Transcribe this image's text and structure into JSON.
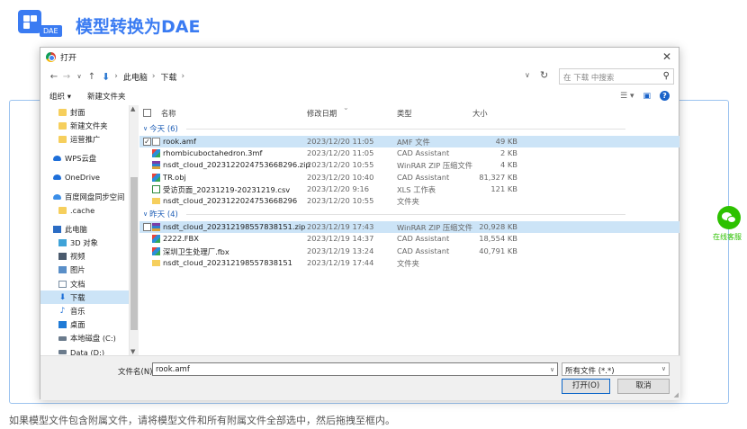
{
  "page": {
    "logo_tag": "DAE",
    "title": "模型转换为DAE",
    "footer_note": "如果模型文件包含附属文件，请将模型文件和所有附属文件全部选中，然后拖拽至框内。",
    "online_service_label": "在线客服"
  },
  "dialog": {
    "title": "打开",
    "close": "✕",
    "breadcrumb": [
      "此电脑",
      "下载"
    ],
    "search_placeholder": "在 下载 中搜索",
    "toolbar": {
      "organize": "组织 ▾",
      "new_folder": "新建文件夹"
    },
    "nav_items": [
      {
        "label": "封面",
        "icon": "folder-icon"
      },
      {
        "label": "新建文件夹",
        "icon": "folder-icon"
      },
      {
        "label": "运营推广",
        "icon": "folder-icon"
      },
      {
        "label": "WPS云盘",
        "icon": "cloud-icon"
      },
      {
        "label": "OneDrive",
        "icon": "cloud-icon"
      },
      {
        "label": "百度网盘同步空间",
        "icon": "cloud-drive-icon"
      },
      {
        "label": ".cache",
        "icon": "folder-icon"
      },
      {
        "label": "此电脑",
        "icon": "computer-icon"
      },
      {
        "label": "3D 对象",
        "icon": "3d-objects-icon"
      },
      {
        "label": "视频",
        "icon": "video-icon"
      },
      {
        "label": "图片",
        "icon": "pictures-icon"
      },
      {
        "label": "文档",
        "icon": "documents-icon"
      },
      {
        "label": "下载",
        "icon": "download-icon"
      },
      {
        "label": "音乐",
        "icon": "music-icon"
      },
      {
        "label": "桌面",
        "icon": "desktop-icon"
      },
      {
        "label": "本地磁盘 (C:)",
        "icon": "drive-icon"
      },
      {
        "label": "Data (D:)",
        "icon": "drive-icon"
      }
    ],
    "columns": {
      "name": "名称",
      "date": "修改日期",
      "type": "类型",
      "size": "大小"
    },
    "groups": [
      {
        "label": "今天 (6)",
        "files": [
          {
            "name": "rook.amf",
            "date": "2023/12/20 11:05",
            "type": "AMF 文件",
            "size": "49 KB",
            "icon": "doc",
            "selected": true
          },
          {
            "name": "rhombicuboctahedron.3mf",
            "date": "2023/12/20 11:05",
            "type": "CAD Assistant",
            "size": "2 KB",
            "icon": "cad"
          },
          {
            "name": "nsdt_cloud_202312202475366829​6.zip",
            "date": "2023/12/20 10:55",
            "type": "WinRAR ZIP 压缩文件",
            "size": "4 KB",
            "icon": "zip"
          },
          {
            "name": "TR.obj",
            "date": "2023/12/20 10:40",
            "type": "CAD Assistant",
            "size": "81,327 KB",
            "icon": "cad"
          },
          {
            "name": "受访页面_20231219-20231219.csv",
            "date": "2023/12/20 9:16",
            "type": "XLS 工作表",
            "size": "121 KB",
            "icon": "xls"
          },
          {
            "name": "nsdt_cloud_20231220247536682​96",
            "date": "2023/12/20 10:55",
            "type": "文件夹",
            "size": "",
            "icon": "folder"
          }
        ]
      },
      {
        "label": "昨天 (4)",
        "files": [
          {
            "name": "nsdt_cloud_202312198557838151.zip",
            "date": "2023/12/19 17:43",
            "type": "WinRAR ZIP 压缩文件",
            "size": "20,928 KB",
            "icon": "zip",
            "hover": true
          },
          {
            "name": "2222.FBX",
            "date": "2023/12/19 14:37",
            "type": "CAD Assistant",
            "size": "18,554 KB",
            "icon": "cad"
          },
          {
            "name": "深圳卫生处理厂.fbx",
            "date": "2023/12/19 13:24",
            "type": "CAD Assistant",
            "size": "40,791 KB",
            "icon": "cad"
          },
          {
            "name": "nsdt_cloud_202312198557838151",
            "date": "2023/12/19 17:44",
            "type": "文件夹",
            "size": "",
            "icon": "folder"
          }
        ]
      }
    ],
    "filename_label": "文件名(N):",
    "filename_value": "rook.amf",
    "filetype": "所有文件 (*.*)",
    "open_button": "打开(O)",
    "cancel_button": "取消"
  }
}
